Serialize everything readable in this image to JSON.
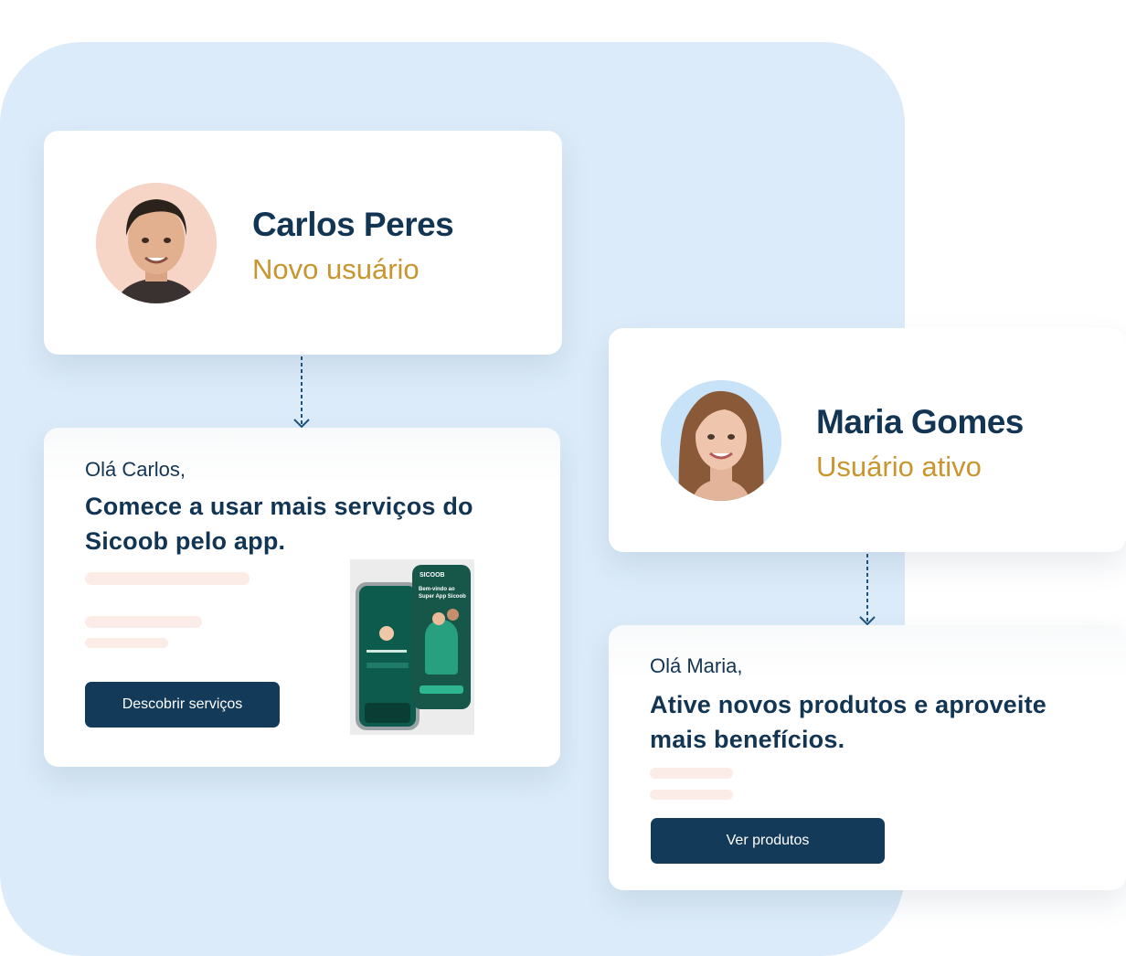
{
  "colors": {
    "navy": "#123553",
    "gold": "#c9952f",
    "panel": "#dbebf9",
    "button": "#143a59",
    "placeholder": "#fbece7"
  },
  "profiles": [
    {
      "name": "Carlos Peres",
      "status": "Novo usuário",
      "avatar_bg": "#f6d5c7"
    },
    {
      "name": "Maria Gomes",
      "status": "Usuário ativo",
      "avatar_bg": "#c8e2f7"
    }
  ],
  "messages": [
    {
      "greeting": "Olá Carlos,",
      "headline_line1": "Comece a usar mais serviços do",
      "headline_line2": "Sicoob pelo app.",
      "button": "Descobrir serviços"
    },
    {
      "greeting": "Olá Maria,",
      "headline_line1": "Ative novos produtos e aproveite",
      "headline_line2": "mais benefícios.",
      "button": "Ver produtos"
    }
  ],
  "app_mockup": {
    "brand": "SICOOB",
    "welcome_line1": "Bem-vindo ao",
    "welcome_line2": "Super App Sicoob"
  }
}
